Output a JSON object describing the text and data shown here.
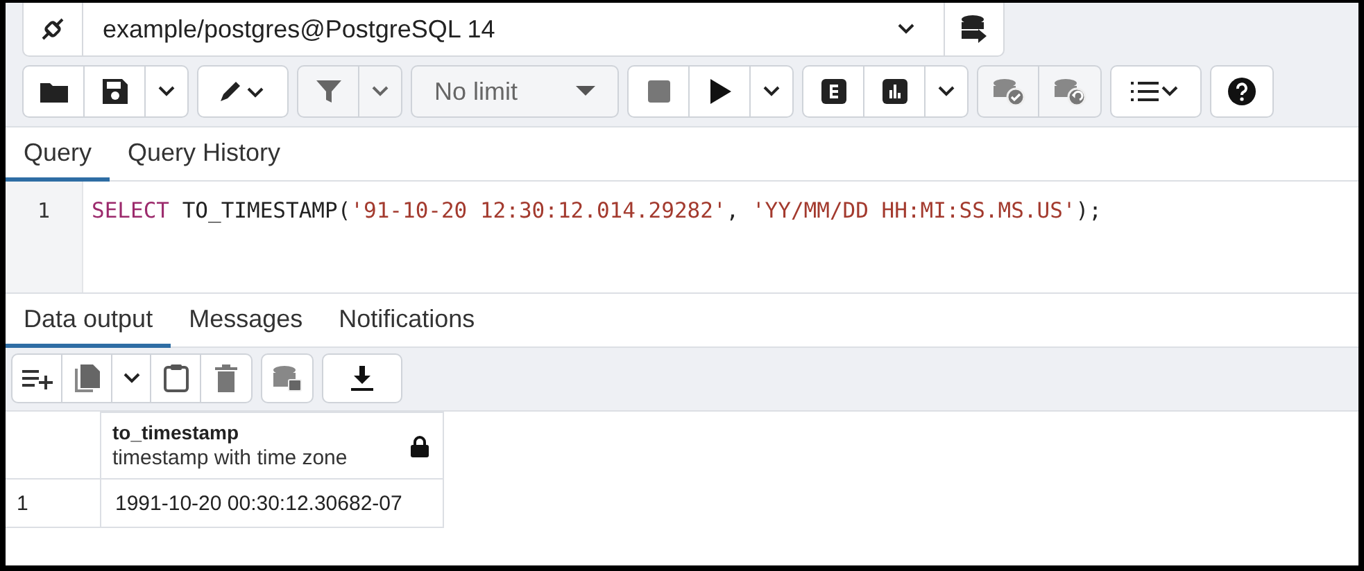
{
  "connection": {
    "value": "example/postgres@PostgreSQL 14"
  },
  "toolbar": {
    "row_limit": "No limit"
  },
  "query_tabs": [
    {
      "label": "Query",
      "selected": true
    },
    {
      "label": "Query History",
      "selected": false
    }
  ],
  "editor": {
    "lines": [
      {
        "number": "1",
        "tokens": [
          {
            "kind": "keyword",
            "text": "SELECT"
          },
          {
            "kind": "plain",
            "text": " TO_TIMESTAMP("
          },
          {
            "kind": "string",
            "text": "'91-10-20 12:30:12.014.29282'"
          },
          {
            "kind": "plain",
            "text": ", "
          },
          {
            "kind": "string",
            "text": "'YY/MM/DD HH:MI:SS.MS.US'"
          },
          {
            "kind": "plain",
            "text": ");"
          }
        ]
      }
    ]
  },
  "result_tabs": [
    {
      "label": "Data output",
      "selected": true
    },
    {
      "label": "Messages",
      "selected": false
    },
    {
      "label": "Notifications",
      "selected": false
    }
  ],
  "grid": {
    "columns": [
      {
        "name": "to_timestamp",
        "type": "timestamp with time zone",
        "locked": true
      }
    ],
    "rows": [
      {
        "number": "1",
        "cells": [
          "1991-10-20 00:30:12.30682-07"
        ]
      }
    ]
  }
}
